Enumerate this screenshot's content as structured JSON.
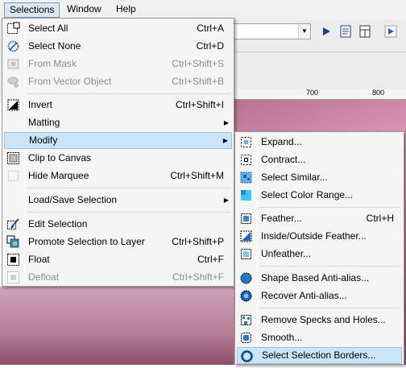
{
  "menubar": {
    "items": [
      "Selections",
      "Window",
      "Help"
    ]
  },
  "ruler": {
    "labels": [
      "700",
      "800"
    ]
  },
  "selections_menu": {
    "items": [
      {
        "label": "Select All",
        "shortcut": "Ctrl+A",
        "icon": "select-all-icon"
      },
      {
        "label": "Select None",
        "shortcut": "Ctrl+D",
        "icon": "select-none-icon"
      },
      {
        "label": "From Mask",
        "shortcut": "Ctrl+Shift+S",
        "icon": "from-mask-icon",
        "disabled": true
      },
      {
        "label": "From Vector Object",
        "shortcut": "Ctrl+Shift+B",
        "icon": "from-vector-icon",
        "disabled": true
      },
      {
        "label": "Invert",
        "shortcut": "Ctrl+Shift+I",
        "icon": "invert-icon"
      },
      {
        "label": "Matting",
        "shortcut": "",
        "submenu": true
      },
      {
        "label": "Modify",
        "shortcut": "",
        "submenu": true,
        "highlighted": true
      },
      {
        "label": "Clip to Canvas",
        "shortcut": "",
        "icon": "clip-canvas-icon"
      },
      {
        "label": "Hide Marquee",
        "shortcut": "Ctrl+Shift+M",
        "icon": "hide-marquee-icon"
      },
      {
        "label": "Load/Save Selection",
        "shortcut": "",
        "submenu": true
      },
      {
        "label": "Edit Selection",
        "shortcut": "",
        "icon": "edit-selection-icon"
      },
      {
        "label": "Promote Selection to Layer",
        "shortcut": "Ctrl+Shift+P",
        "icon": "promote-layer-icon"
      },
      {
        "label": "Float",
        "shortcut": "Ctrl+F",
        "icon": "float-icon"
      },
      {
        "label": "Defloat",
        "shortcut": "Ctrl+Shift+F",
        "icon": "defloat-icon",
        "disabled": true
      }
    ]
  },
  "modify_menu": {
    "items": [
      {
        "label": "Expand...",
        "shortcut": "",
        "icon": "expand-icon"
      },
      {
        "label": "Contract...",
        "shortcut": "",
        "icon": "contract-icon"
      },
      {
        "label": "Select Similar...",
        "shortcut": "",
        "icon": "select-similar-icon"
      },
      {
        "label": "Select Color Range...",
        "shortcut": "",
        "icon": "color-range-icon"
      },
      {
        "label": "Feather...",
        "shortcut": "Ctrl+H",
        "icon": "feather-icon"
      },
      {
        "label": "Inside/Outside Feather...",
        "shortcut": "",
        "icon": "inside-outside-feather-icon"
      },
      {
        "label": "Unfeather...",
        "shortcut": "",
        "icon": "unfeather-icon"
      },
      {
        "label": "Shape Based Anti-alias...",
        "shortcut": "",
        "icon": "shape-antialias-icon"
      },
      {
        "label": "Recover Anti-alias...",
        "shortcut": "",
        "icon": "recover-antialias-icon"
      },
      {
        "label": "Remove Specks and Holes...",
        "shortcut": "",
        "icon": "remove-specks-icon"
      },
      {
        "label": "Smooth...",
        "shortcut": "",
        "icon": "smooth-icon"
      },
      {
        "label": "Select Selection Borders...",
        "shortcut": "",
        "icon": "selection-borders-icon",
        "highlighted": true
      }
    ]
  },
  "colors": {
    "highlight": "#cce4f7",
    "highlight_border": "#98c2e6",
    "disabled_text": "#8d8d8d"
  }
}
